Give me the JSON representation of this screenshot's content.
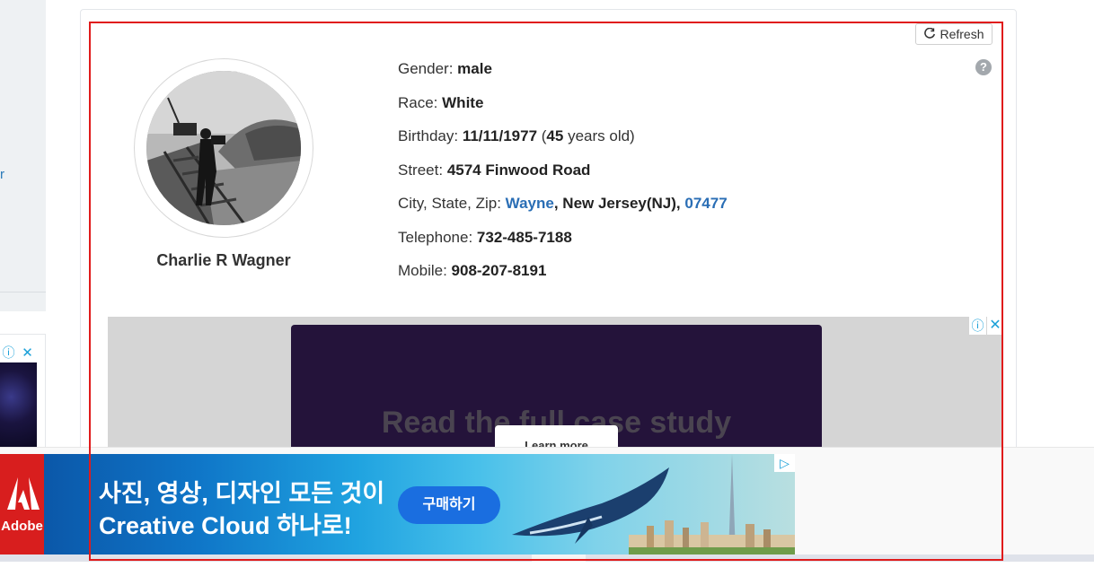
{
  "left_sidebar": {
    "fragment_text": "r"
  },
  "left_ad": {
    "info_icon": "info-icon",
    "close_icon": "close-icon"
  },
  "profile": {
    "refresh_label": "Refresh",
    "help_icon": "?",
    "name": "Charlie R Wagner",
    "gender_label": "Gender: ",
    "gender": "male",
    "race_label": "Race: ",
    "race": "White",
    "birthday_label": "Birthday: ",
    "birthday": "11/11/1977",
    "age_open": " (",
    "age": "45",
    "age_suffix": " years old)",
    "street_label": "Street: ",
    "street": "4574 Finwood Road",
    "city_label": "City, State, Zip: ",
    "city": "Wayne",
    "sep1": ", ",
    "state": "New Jersey(NJ)",
    "sep2": ", ",
    "zip": "07477",
    "telephone_label": "Telephone: ",
    "telephone": "732-485-7188",
    "mobile_label": "Mobile: ",
    "mobile": "908-207-8191"
  },
  "inline_ad": {
    "headline": "Read the full case study",
    "cta": "Learn more",
    "info_icon": "ⓘ",
    "close_icon": "✕"
  },
  "bottom_banner": {
    "brand": "Adobe",
    "line1": "사진, 영상, 디자인 모든 것이",
    "line2": "Creative Cloud 하나로!",
    "cta": "구매하기",
    "adchoices_icon": "▷"
  },
  "colors": {
    "highlight": "#e01b1b",
    "link": "#2a6eb5",
    "ad_bg": "#24133a",
    "banner_button": "#1a6ee0"
  }
}
